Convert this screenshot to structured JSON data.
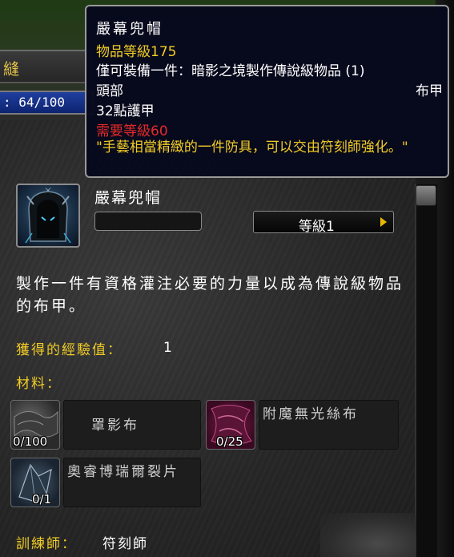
{
  "frame": {
    "header_label": "縫",
    "skill_bar_text": ": 64/100"
  },
  "recipe": {
    "item_name": "嚴幕兜帽",
    "name_field_value": "",
    "rank_label": "等級1",
    "description": "製作一件有資格灌注必要的力量以成為傳說級物品的布甲。",
    "xp_label": "獲得的經驗值：",
    "xp_value": "1",
    "reagents_label": "材料：",
    "reagents": [
      {
        "name": "罩影布",
        "count": "0/100",
        "icon": "shadowcloth-icon"
      },
      {
        "name": "附魔無光絲布",
        "count": "0/25",
        "icon": "enchanted-lightless-silk-icon"
      },
      {
        "name": "奧睿博瑞爾裂片",
        "count": "0/1",
        "icon": "orborus-shard-icon"
      }
    ],
    "trainer_label": "訓練師：",
    "trainer_value": "符刻師"
  },
  "tooltip": {
    "title": "嚴幕兜帽",
    "item_level": "物品等級175",
    "unique": "僅可裝備一件：暗影之境製作傳說級物品 (1)",
    "slot": "頭部",
    "armor_type": "布甲",
    "armor": "32點護甲",
    "requires_level": "需要等級60",
    "flavor": "\"手藝相當精緻的一件防具，可以交由符刻師強化。\""
  },
  "colors": {
    "gold": "#f2cc26",
    "requirement_red": "#e62a2a",
    "tooltip_bg": "#06081c",
    "skill_bar_blue": "#1f3f9e"
  }
}
